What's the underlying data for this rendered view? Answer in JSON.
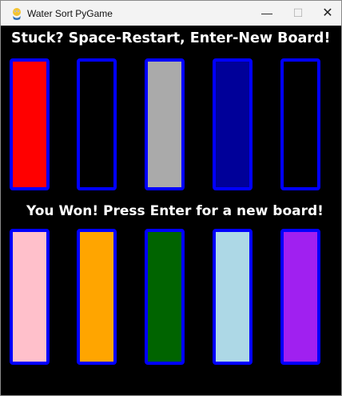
{
  "window": {
    "title": "Water Sort PyGame",
    "minimize_glyph": "—",
    "maximize_glyph": "☐",
    "close_glyph": "✕"
  },
  "messages": {
    "top": "Stuck? Space-Restart, Enter-New Board!",
    "bottom": "You Won! Press Enter for a new board!"
  },
  "colors": {
    "tube_border": "#0000ff",
    "background": "#000000"
  },
  "tubes": [
    {
      "name": "tube-1",
      "color": "#ff0000"
    },
    {
      "name": "tube-2",
      "color": "#000000"
    },
    {
      "name": "tube-3",
      "color": "#aaaaaa"
    },
    {
      "name": "tube-4",
      "color": "#000099"
    },
    {
      "name": "tube-5",
      "color": "#000000"
    },
    {
      "name": "tube-6",
      "color": "#ffc0cb"
    },
    {
      "name": "tube-7",
      "color": "#ffa500"
    },
    {
      "name": "tube-8",
      "color": "#006400"
    },
    {
      "name": "tube-9",
      "color": "#add8e6"
    },
    {
      "name": "tube-10",
      "color": "#a020f0"
    }
  ]
}
